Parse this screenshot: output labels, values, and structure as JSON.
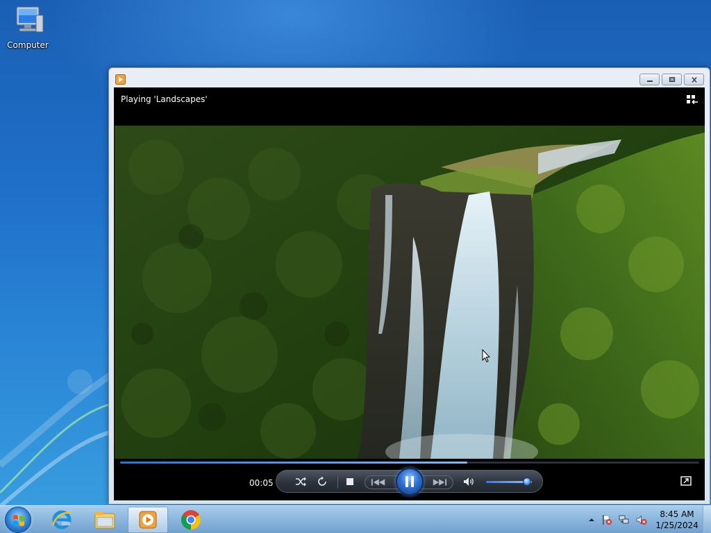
{
  "desktop": {
    "icons": [
      {
        "label": "Computer",
        "icon": "computer-icon"
      }
    ]
  },
  "window": {
    "app_icon": "media-player-icon",
    "controls": {
      "minimize": "minimize-icon",
      "maximize": "maximize-icon",
      "close": "close-icon"
    },
    "now_playing": "Playing 'Landscapes'",
    "switch_icon": "switch-to-library-icon",
    "playback": {
      "elapsed": "00:05",
      "progress_fraction": 0.6,
      "volume_fraction": 0.9,
      "state": "playing"
    },
    "buttons": [
      "shuffle-icon",
      "repeat-icon",
      "stop-icon",
      "previous-icon",
      "pause-icon",
      "next-icon",
      "volume-icon",
      "fullscreen-icon"
    ]
  },
  "taskbar": {
    "start_icon": "windows-start-icon",
    "items": [
      {
        "icon": "internet-explorer-icon"
      },
      {
        "icon": "file-explorer-icon"
      },
      {
        "icon": "media-player-icon",
        "active": true
      },
      {
        "icon": "chrome-icon"
      }
    ],
    "tray": {
      "icons": [
        "show-hidden-icons-icon",
        "action-center-flag-icon",
        "network-icon",
        "volume-muted-icon"
      ],
      "time": "8:45 AM",
      "date": "1/25/2024"
    }
  },
  "colors": {
    "accent": "#2d6fd4",
    "desktop_blue": "#1f6fc8",
    "window_frame": "#dbe3ee",
    "player_bg": "#000000"
  }
}
